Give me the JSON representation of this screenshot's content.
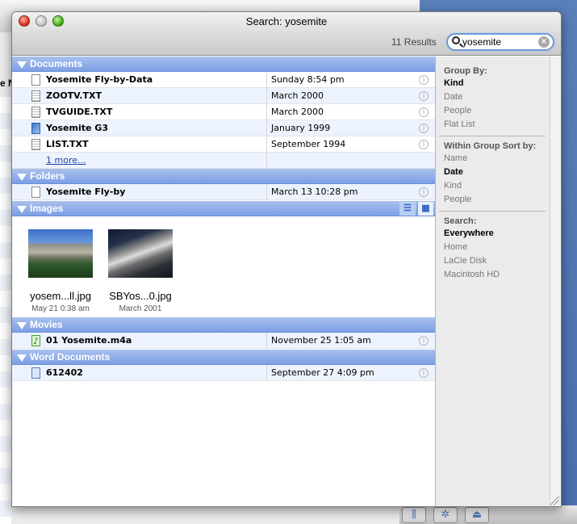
{
  "window": {
    "title": "Search: yosemite",
    "results_count": "11 Results"
  },
  "search": {
    "value": "yosemite",
    "clear_icon": "clear-icon"
  },
  "background": {
    "fragment": "e N"
  },
  "groups": {
    "documents": {
      "label": "Documents",
      "rows": [
        {
          "name": "Yosemite Fly-by-Data",
          "date": "Sunday 8:54 pm",
          "icon": "document-icon"
        },
        {
          "name": "ZOOTV.TXT",
          "date": "March 2000",
          "icon": "text-file-icon"
        },
        {
          "name": "TVGUIDE.TXT",
          "date": "March 2000",
          "icon": "text-file-icon"
        },
        {
          "name": "Yosemite G3",
          "date": "January 1999",
          "icon": "application-icon"
        },
        {
          "name": "LIST.TXT",
          "date": "September 1994",
          "icon": "text-file-icon"
        }
      ],
      "more": "1 more..."
    },
    "folders": {
      "label": "Folders",
      "rows": [
        {
          "name": "Yosemite Fly-by",
          "date": "March 13 10:28 pm",
          "icon": "document-icon"
        }
      ]
    },
    "images": {
      "label": "Images",
      "items": [
        {
          "name": "yosem...ll.jpg",
          "date": "May 21 0:38 am"
        },
        {
          "name": "SBYos...0.jpg",
          "date": "March 2001"
        }
      ]
    },
    "movies": {
      "label": "Movies",
      "rows": [
        {
          "name": "01 Yosemite.m4a",
          "date": "November 25 1:05 am",
          "icon": "audio-file-icon"
        }
      ]
    },
    "word_documents": {
      "label": "Word Documents",
      "rows": [
        {
          "name": "612402",
          "date": "September 27 4:09 pm",
          "icon": "word-document-icon"
        }
      ]
    }
  },
  "panel": {
    "group_by": {
      "label": "Group By:",
      "options": [
        "Kind",
        "Date",
        "People",
        "Flat List"
      ],
      "selected": "Kind"
    },
    "sort_by": {
      "label": "Within Group Sort by:",
      "options": [
        "Name",
        "Date",
        "Kind",
        "People"
      ],
      "selected": "Date"
    },
    "search_in": {
      "label": "Search:",
      "options": [
        "Everywhere",
        "Home",
        "LaCie Disk",
        "Macintosh HD"
      ],
      "selected": "Everywhere"
    }
  },
  "colors": {
    "group_header": "#7c9fe4",
    "row_alt": "#edf3fe",
    "panel_bg": "#ebebeb"
  }
}
